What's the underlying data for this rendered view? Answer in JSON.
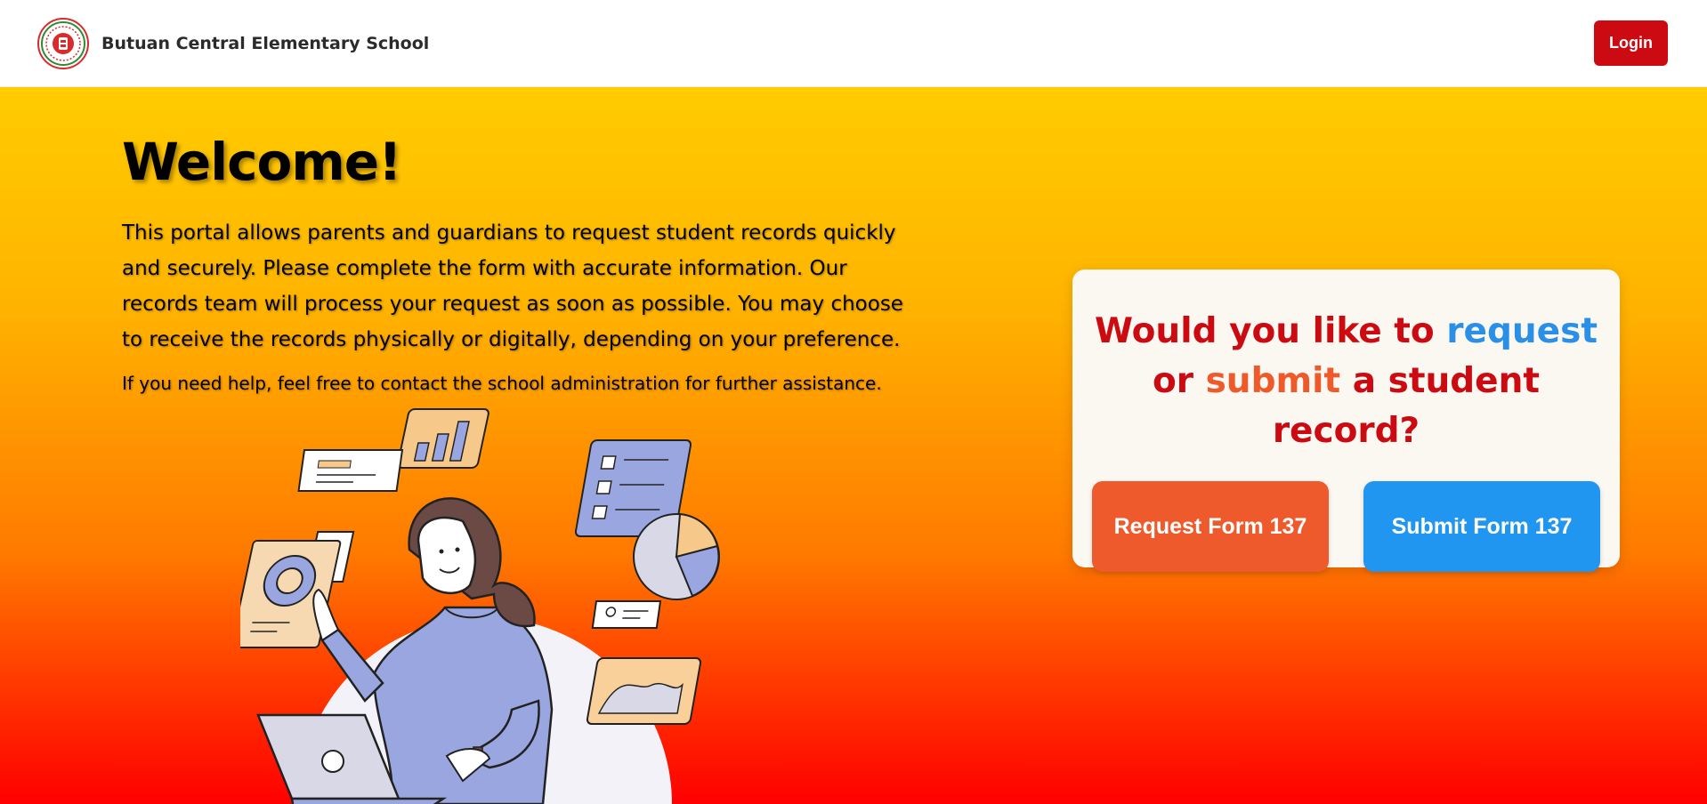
{
  "header": {
    "school_name": "Butuan Central Elementary School",
    "login_label": "Login"
  },
  "intro": {
    "title": "Welcome!",
    "paragraph": "This portal allows parents and guardians to request student records quickly and securely. Please complete the form with accurate information. Our records team will process your request as soon as possible. You may choose to receive the records physically or digitally, depending on your preference.",
    "help_text": "If you need help, feel free to contact the school administration for further assistance."
  },
  "card": {
    "question_part1": "Would you like to ",
    "question_request": "request",
    "question_part2": " or ",
    "question_submit": "submit",
    "question_part3": " a student record?",
    "request_button": "Request Form 137",
    "submit_button": "Submit Form 137"
  },
  "colors": {
    "brand_red": "#cc0a12",
    "request_orange": "#ef5a2c",
    "submit_blue": "#2196f0",
    "hero_gradient_top": "#ffcc00",
    "hero_gradient_bottom": "#ff0000"
  },
  "icons": {
    "logo": "school-seal-logo",
    "illustration": "woman-with-laptop-and-documents"
  }
}
